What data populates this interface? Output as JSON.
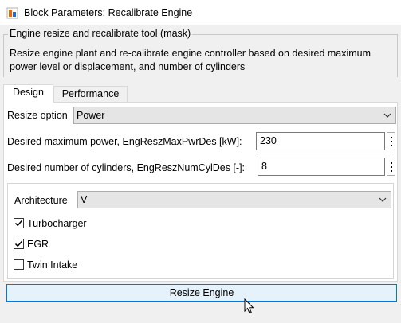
{
  "window": {
    "title": "Block Parameters: Recalibrate Engine"
  },
  "mask": {
    "type": "Engine resize and recalibrate tool (mask)",
    "description": "Resize engine plant and re-calibrate engine controller based on desired maximum power level or displacement, and number of cylinders"
  },
  "tabs": [
    {
      "label": "Design",
      "active": true
    },
    {
      "label": "Performance",
      "active": false
    }
  ],
  "design": {
    "resize_option": {
      "label": "Resize option",
      "value": "Power"
    },
    "max_power": {
      "label": "Desired maximum power, EngReszMaxPwrDes [kW]:",
      "value": "230"
    },
    "num_cylinders": {
      "label": "Desired number of cylinders, EngReszNumCylDes [-]:",
      "value": "8"
    },
    "architecture": {
      "label": "Architecture",
      "value": "V"
    },
    "checkboxes": [
      {
        "label": "Turbocharger",
        "checked": true
      },
      {
        "label": "EGR",
        "checked": true
      },
      {
        "label": "Twin Intake",
        "checked": false
      }
    ]
  },
  "actions": {
    "resize_button": "Resize Engine"
  },
  "icons": {
    "window": "simulink-block-icon",
    "dropdown": "chevron-down-icon",
    "param_menu": "vertical-ellipsis-icon",
    "checkmark": "checkmark-icon",
    "cursor": "mouse-pointer-icon"
  }
}
